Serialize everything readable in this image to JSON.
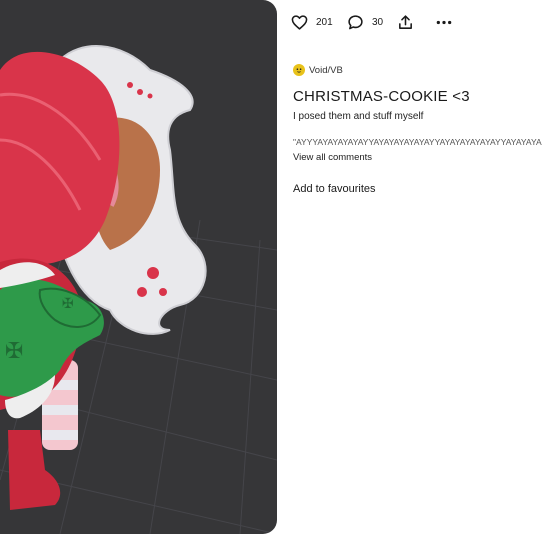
{
  "viewer": {
    "description_icon": "3d-model-view"
  },
  "stats": {
    "likes": "201",
    "comments": "30",
    "like_icon": "heart-icon",
    "comment_icon": "speech-bubble-icon",
    "share_icon": "share-upload-icon",
    "more_icon": "more-horizontal-icon"
  },
  "post": {
    "author": "Void/VB",
    "title": "CHRISTMAS-COOKIE <3",
    "description": "I posed them and stuff myself",
    "comment_preview": "\"AYYYAYAYAYAYAYYAYAYAYAYAYAYYAYAYAYAYAYAYYAYAYAYA",
    "view_all_comments": "View all comments",
    "add_to_favourites": "Add to favourites"
  },
  "colors": {
    "viewer_bg": "#363638",
    "accent_red": "#d9344a",
    "avatar_yellow": "#e8c21a"
  }
}
